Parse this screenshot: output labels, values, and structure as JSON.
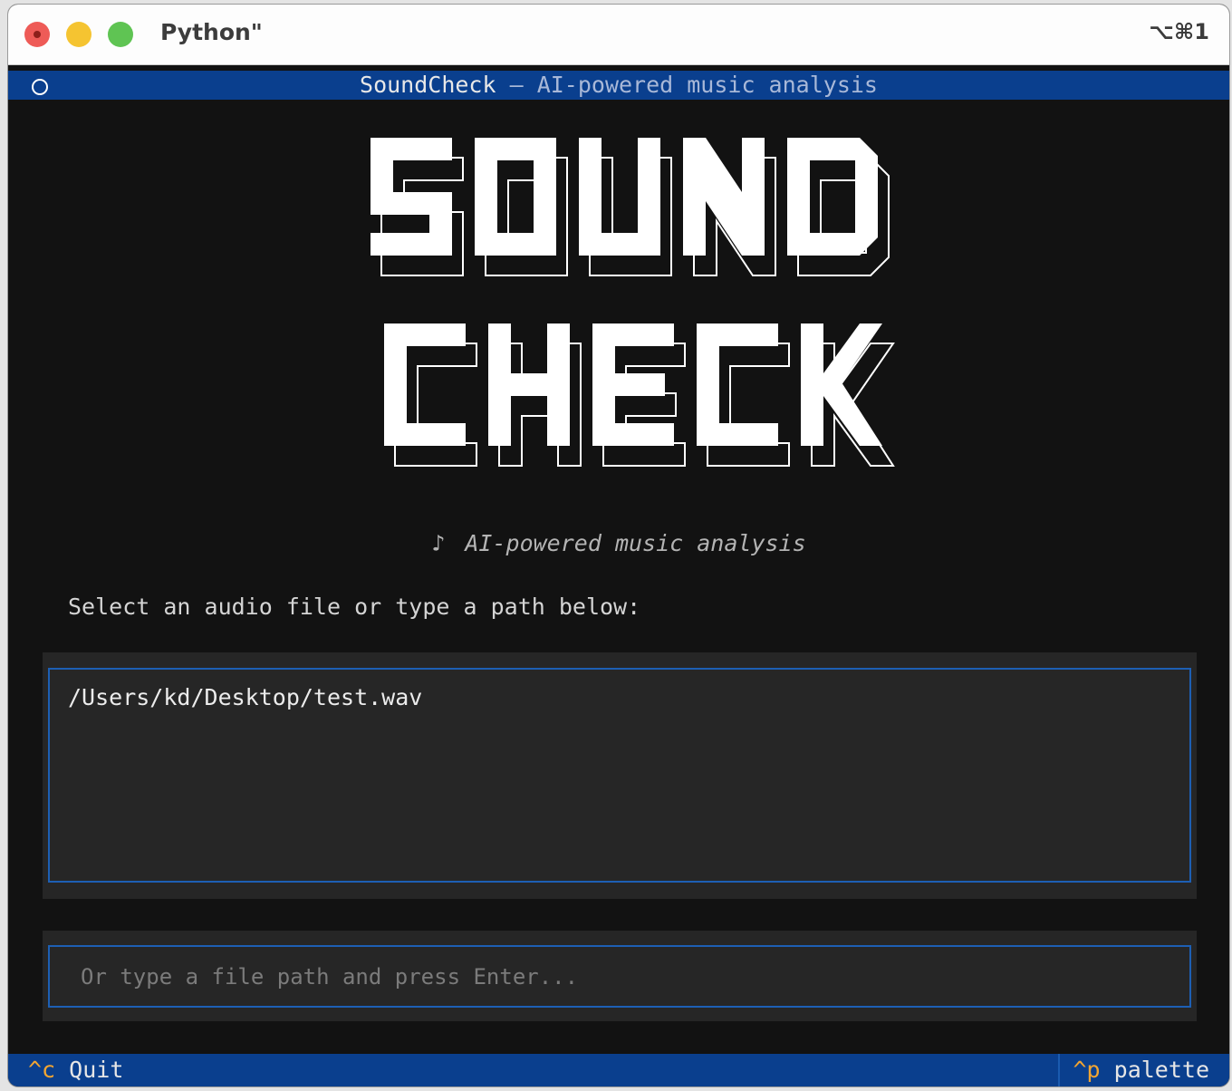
{
  "window": {
    "title": "Python\"",
    "shortcut": "⌥⌘1"
  },
  "header": {
    "app_name": "SoundCheck",
    "separator": " — ",
    "subtitle": "AI-powered music analysis"
  },
  "logo": {
    "line1": "SOUND",
    "line2": "CHECK"
  },
  "tagline": {
    "icon": "♪",
    "text": "AI-powered music analysis"
  },
  "prompt": "Select an audio file or type a path below:",
  "file_list": {
    "items": [
      "/Users/kd/Desktop/test.wav"
    ]
  },
  "path_input": {
    "placeholder": "Or type a file path and press Enter...",
    "value": ""
  },
  "footer": {
    "quit_key": "^c",
    "quit_label": "Quit",
    "palette_key": "^p",
    "palette_label": "palette"
  },
  "colors": {
    "header_bar": "#0a3f8e",
    "focus_border": "#1d5fb4",
    "key_accent": "#f2a531",
    "background": "#121212"
  }
}
